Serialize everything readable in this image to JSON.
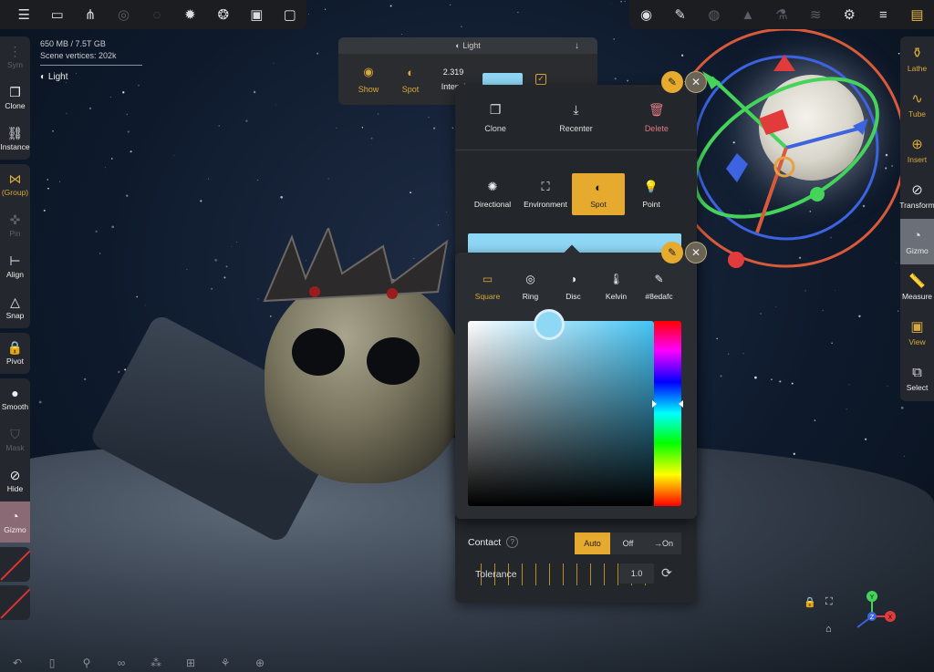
{
  "stats": {
    "memory": "650 MB / 7.5T GB",
    "vertices": "Scene vertices: 202k",
    "selected": "Light"
  },
  "topbar_left": [
    {
      "name": "menu-icon",
      "glyph": "☰"
    },
    {
      "name": "folder-icon",
      "glyph": "▭"
    },
    {
      "name": "scene-tree-icon",
      "glyph": "⋔"
    },
    {
      "name": "layers-icon",
      "glyph": "◎"
    },
    {
      "name": "material-icon",
      "glyph": "◌"
    },
    {
      "name": "sun-icon",
      "glyph": "✹"
    },
    {
      "name": "camera-lens-icon",
      "glyph": "❂"
    },
    {
      "name": "image-icon",
      "glyph": "▣"
    },
    {
      "name": "video-icon",
      "glyph": "▢"
    }
  ],
  "topbar_right": [
    {
      "name": "light-gizmo-icon",
      "glyph": "◉"
    },
    {
      "name": "brush-icon",
      "glyph": "✎"
    },
    {
      "name": "globe-icon",
      "glyph": "◍"
    },
    {
      "name": "triangle-icon",
      "glyph": "▲"
    },
    {
      "name": "flask-icon",
      "glyph": "⚗"
    },
    {
      "name": "stack-icon",
      "glyph": "≋"
    },
    {
      "name": "gear-icon",
      "glyph": "⚙"
    },
    {
      "name": "sliders-icon",
      "glyph": "≡"
    },
    {
      "name": "gold-menu-icon",
      "glyph": "▤"
    }
  ],
  "left_bar": [
    {
      "group": 1,
      "label": "Sym",
      "glyph": "⋮",
      "style": "dim"
    },
    {
      "group": 1,
      "label": "Clone",
      "glyph": "❐",
      "style": "plain"
    },
    {
      "group": 1,
      "label": "Instance",
      "glyph": "⛓",
      "style": "plain"
    },
    {
      "group": 2,
      "label": "(Group)",
      "glyph": "⋈",
      "style": "gold"
    },
    {
      "group": 2,
      "label": "Pin",
      "glyph": "✜",
      "style": "dim"
    },
    {
      "group": 2,
      "label": "Align",
      "glyph": "⊢",
      "style": "plain"
    },
    {
      "group": 2,
      "label": "Snap",
      "glyph": "△",
      "style": "plain"
    },
    {
      "group": 3,
      "label": "Pivot",
      "glyph": "🔒",
      "style": "plain"
    },
    {
      "group": 4,
      "label": "Smooth",
      "glyph": "●",
      "style": "plain"
    },
    {
      "group": 4,
      "label": "Mask",
      "glyph": "⛉",
      "style": "dim"
    },
    {
      "group": 4,
      "label": "Hide",
      "glyph": "⊘",
      "style": "plain"
    },
    {
      "group": 4,
      "label": "Gizmo",
      "glyph": "◔",
      "style": "active"
    }
  ],
  "right_bar": [
    {
      "label": "Lathe",
      "glyph": "⚱",
      "style": "gold"
    },
    {
      "label": "Tube",
      "glyph": "∿",
      "style": "gold"
    },
    {
      "label": "Insert",
      "glyph": "⊕",
      "style": "gold"
    },
    {
      "label": "Transform",
      "glyph": "⊘",
      "style": "plain"
    },
    {
      "label": "Gizmo",
      "glyph": "◔",
      "style": "active"
    },
    {
      "label": "Measure",
      "glyph": "📏",
      "style": "plain"
    },
    {
      "label": "View",
      "glyph": "▣",
      "style": "gold"
    },
    {
      "label": "Select",
      "glyph": "⧉",
      "style": "plain"
    }
  ],
  "light_toolbar": {
    "title": "Light",
    "show": "Show",
    "spot": "Spot",
    "intensity_value": "2.319",
    "intensity_label": "Intensi",
    "color": "#8ed7f5"
  },
  "light_panel": {
    "actions": {
      "clone": "Clone",
      "recenter": "Recenter",
      "delete": "Delete"
    },
    "types": [
      {
        "label": "Directional",
        "glyph": "✺",
        "active": false
      },
      {
        "label": "Environment",
        "glyph": "⛶",
        "active": false
      },
      {
        "label": "Spot",
        "glyph": "◐",
        "active": true
      },
      {
        "label": "Point",
        "glyph": "💡",
        "active": false
      }
    ],
    "color": "#8ed7f5",
    "contact_label": "Contact",
    "contact_options": [
      {
        "label": "Auto",
        "on": true
      },
      {
        "label": "Off",
        "on": false
      },
      {
        "label": "→On",
        "on": false
      }
    ],
    "tolerance_label": "Tolerance",
    "tolerance_value": "1.0"
  },
  "color_picker": {
    "modes": [
      {
        "label": "Square",
        "glyph": "▭",
        "active": true
      },
      {
        "label": "Ring",
        "glyph": "◎",
        "active": false
      },
      {
        "label": "Disc",
        "glyph": "◑",
        "active": false
      },
      {
        "label": "Kelvin",
        "glyph": "🌡",
        "active": false
      },
      {
        "label": "#8edafc",
        "glyph": "✎",
        "active": false
      }
    ],
    "hex": "#8edafc"
  },
  "bottom_bar": [
    {
      "name": "undo-icon",
      "glyph": "↶"
    },
    {
      "name": "phone-icon",
      "glyph": "▯"
    },
    {
      "name": "search-icon",
      "glyph": "⚲"
    },
    {
      "name": "glasses-icon",
      "glyph": "∞"
    },
    {
      "name": "molecule-icon",
      "glyph": "⁂"
    },
    {
      "name": "box-icon",
      "glyph": "⊞"
    },
    {
      "name": "gamepad-icon",
      "glyph": "⚘"
    },
    {
      "name": "zoom-icon",
      "glyph": "⊕"
    }
  ],
  "orientation": {
    "y": "Y",
    "x": "X",
    "z": "Z"
  }
}
